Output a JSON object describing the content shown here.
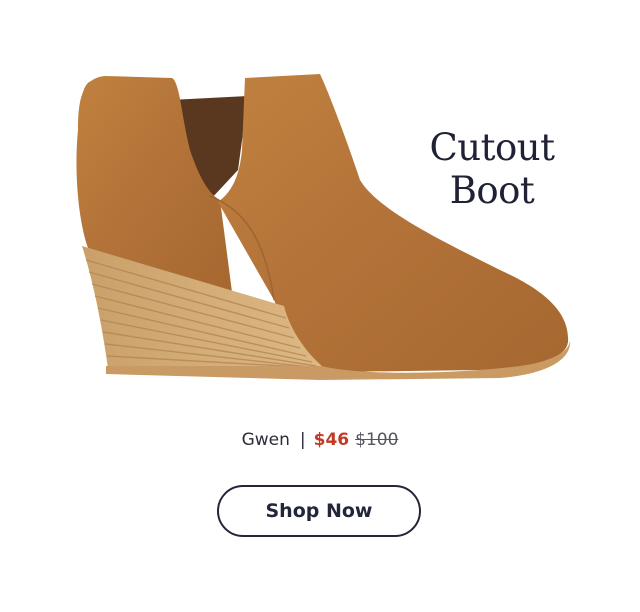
{
  "product": {
    "title_line1": "Cutout",
    "title_line2": "Boot",
    "style_name": "Gwen",
    "separator": "|",
    "sale_price": "$46",
    "original_price": "$100",
    "image": "tan suede cutout wedge ankle boot"
  },
  "cta": {
    "label": "Shop Now"
  },
  "colors": {
    "text": "#1f2235",
    "sale": "#c23a26",
    "boot": "#b4753b"
  }
}
